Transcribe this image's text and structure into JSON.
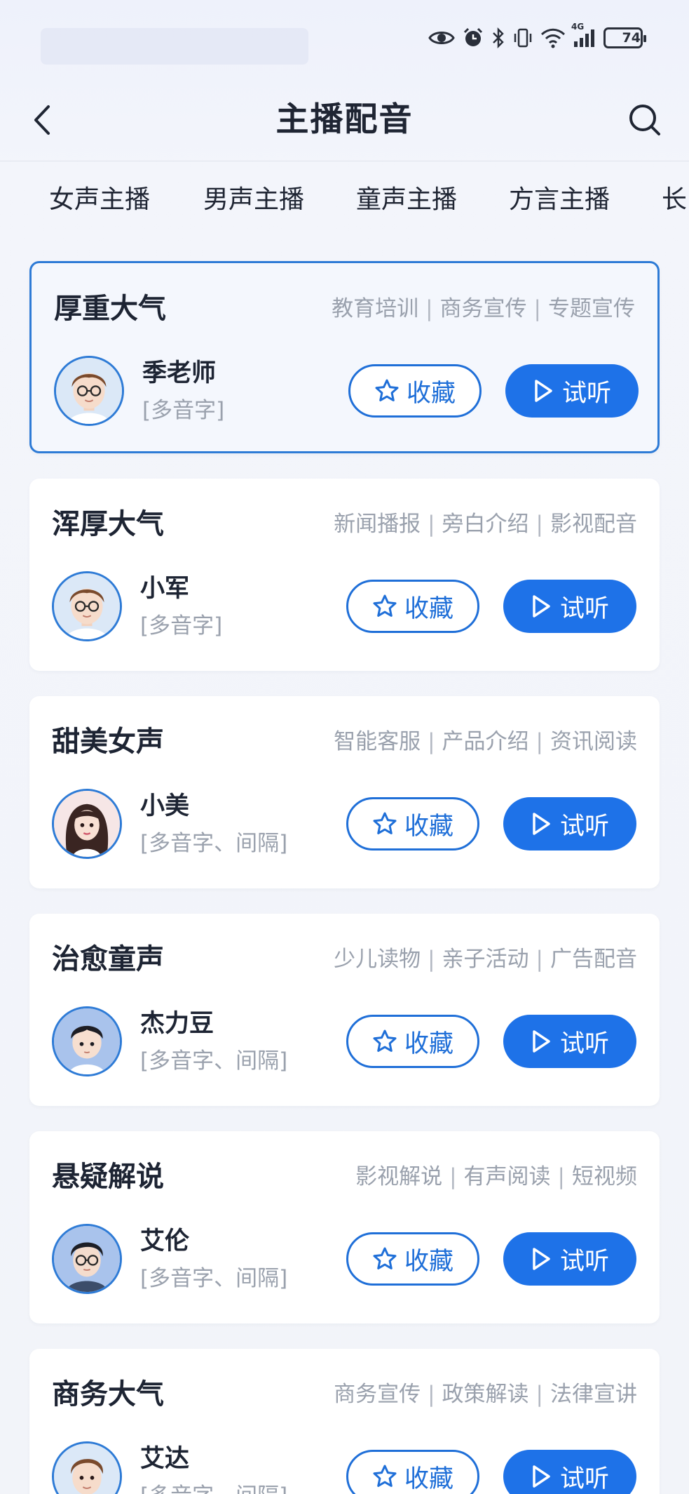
{
  "status_bar": {
    "battery_level": "74",
    "network_label": "4G",
    "icons": [
      "eye-icon",
      "alarm-icon",
      "bluetooth-icon",
      "vibrate-icon",
      "wifi-icon",
      "signal-icon",
      "battery-icon"
    ]
  },
  "header": {
    "title": "主播配音",
    "back_icon": "chevron-left-icon",
    "search_icon": "search-icon"
  },
  "tabs": [
    {
      "label": "女声主播"
    },
    {
      "label": "男声主播"
    },
    {
      "label": "童声主播"
    },
    {
      "label": "方言主播"
    },
    {
      "label": "长"
    }
  ],
  "cards": [
    {
      "title": "厚重大气",
      "tags": [
        "教育培训",
        "商务宣传",
        "专题宣传"
      ],
      "host": "季老师",
      "host_tags": "[多音字]",
      "fav_label": "收藏",
      "play_label": "试听",
      "avatar": "male-glasses-avatar",
      "selected": true
    },
    {
      "title": "浑厚大气",
      "tags": [
        "新闻播报",
        "旁白介绍",
        "影视配音"
      ],
      "host": "小军",
      "host_tags": "[多音字]",
      "fav_label": "收藏",
      "play_label": "试听",
      "avatar": "male-glasses-avatar",
      "selected": false
    },
    {
      "title": "甜美女声",
      "tags": [
        "智能客服",
        "产品介绍",
        "资讯阅读"
      ],
      "host": "小美",
      "host_tags": "[多音字、间隔]",
      "fav_label": "收藏",
      "play_label": "试听",
      "avatar": "female-avatar",
      "selected": false
    },
    {
      "title": "治愈童声",
      "tags": [
        "少儿读物",
        "亲子活动",
        "广告配音"
      ],
      "host": "杰力豆",
      "host_tags": "[多音字、间隔]",
      "fav_label": "收藏",
      "play_label": "试听",
      "avatar": "child-avatar",
      "selected": false
    },
    {
      "title": "悬疑解说",
      "tags": [
        "影视解说",
        "有声阅读",
        "短视频"
      ],
      "host": "艾伦",
      "host_tags": "[多音字、间隔]",
      "fav_label": "收藏",
      "play_label": "试听",
      "avatar": "male-glasses-dark-avatar",
      "selected": false
    },
    {
      "title": "商务大气",
      "tags": [
        "商务宣传",
        "政策解读",
        "法律宣讲"
      ],
      "host": "艾达",
      "host_tags": "[多音字、间隔]",
      "fav_label": "收藏",
      "play_label": "试听",
      "avatar": "male-avatar",
      "selected": false
    }
  ],
  "colors": {
    "accent": "#1e72e8",
    "selected_border": "#2e7bd6",
    "muted_text": "#9aa1ad",
    "background": "#f2f4f9"
  }
}
